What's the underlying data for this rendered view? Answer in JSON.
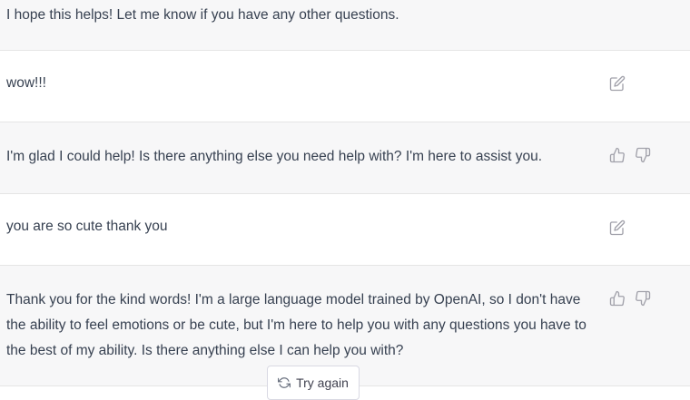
{
  "conversation": {
    "messages": [
      {
        "role": "assistant",
        "text": "I hope this helps! Let me know if you have any other questions."
      },
      {
        "role": "user",
        "text": "wow!!!"
      },
      {
        "role": "assistant",
        "text": "I'm glad I could help! Is there anything else you need help with? I'm here to assist you."
      },
      {
        "role": "user",
        "text": "you are so cute thank you"
      },
      {
        "role": "assistant",
        "text": "Thank you for the kind words! I'm a large language model trained by OpenAI, so I don't have the ability to feel emotions or be cute, but I'm here to help you with any questions you have to the best of my ability. Is there anything else I can help you with?"
      }
    ]
  },
  "footer": {
    "try_again_label": "Try again"
  },
  "icons": {
    "edit": "edit-icon",
    "thumbs_up": "thumbs-up-icon",
    "thumbs_down": "thumbs-down-icon",
    "regenerate": "refresh-icon"
  },
  "colors": {
    "assistant_bg": "#f7f7f8",
    "user_bg": "#ffffff",
    "icon": "#a1a1aa",
    "text": "#374151"
  }
}
